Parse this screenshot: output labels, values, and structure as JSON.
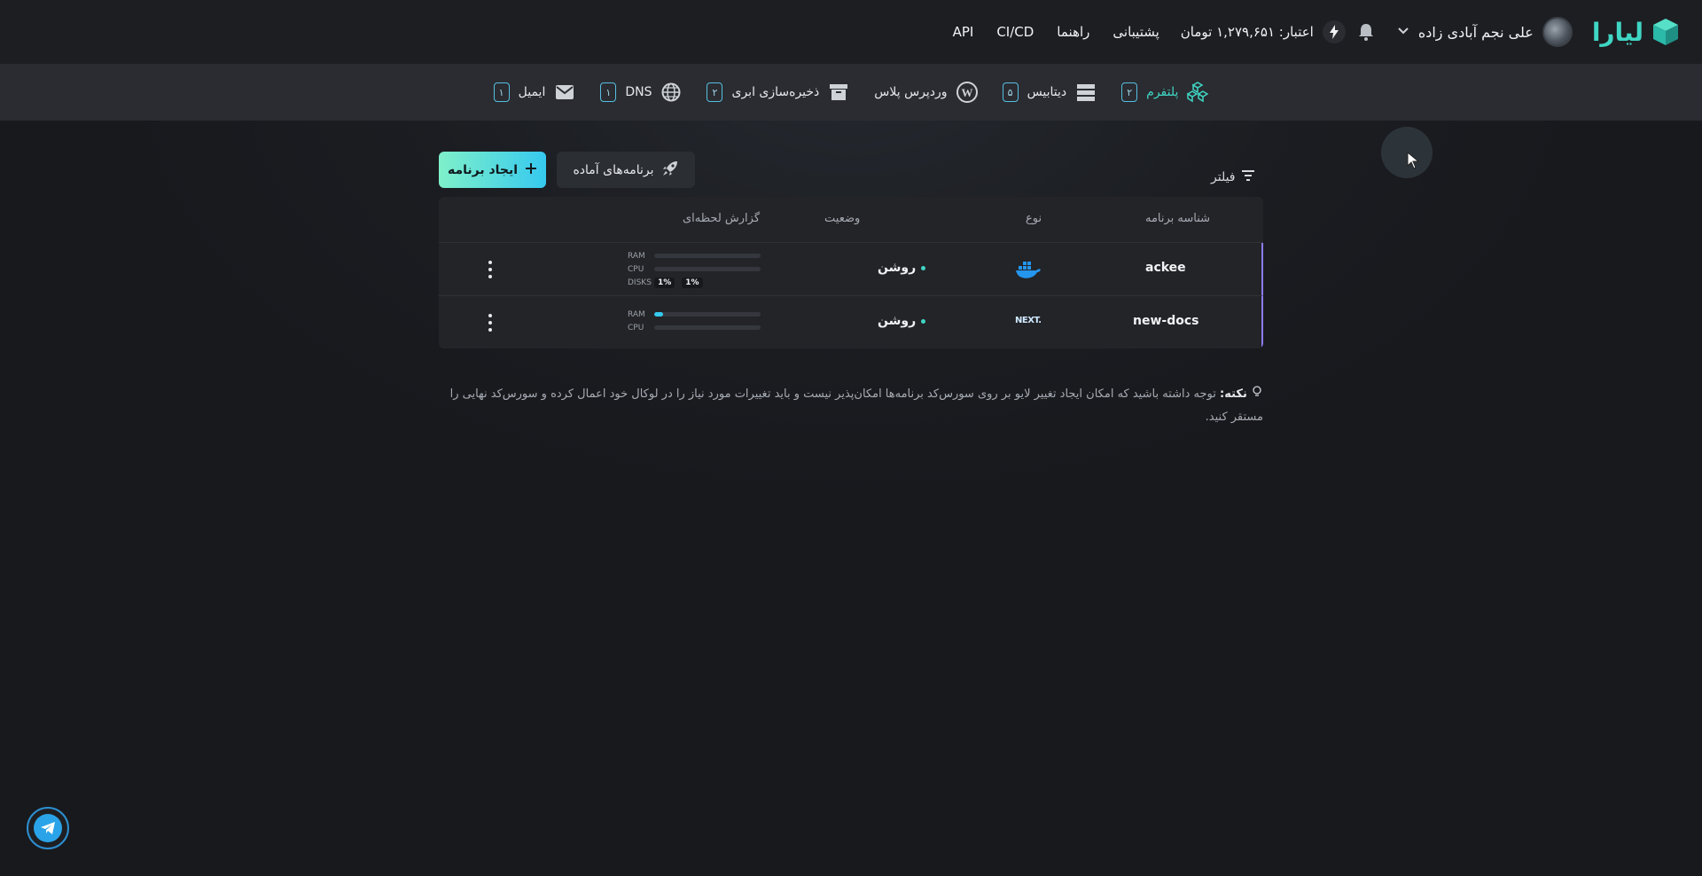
{
  "brand": {
    "name": "لیارا"
  },
  "header": {
    "user_name": "علی نجم آبادی زاده",
    "credit": "اعتبار: ۱,۲۷۹,۶۵۱ تومان",
    "nav": [
      "پشتیبانی",
      "راهنما",
      "CI/CD",
      "API"
    ]
  },
  "services": [
    {
      "label": "پلتفرم",
      "count": "۲",
      "icon": "cubes-icon",
      "active": true
    },
    {
      "label": "دیتابیس",
      "count": "۵",
      "icon": "database-icon"
    },
    {
      "label": "وردپرس پلاس",
      "count": "",
      "icon": "wordpress-icon"
    },
    {
      "label": "ذخیره‌سازی ابری",
      "count": "۲",
      "icon": "archive-icon"
    },
    {
      "label": "DNS",
      "count": "۱",
      "icon": "globe-icon"
    },
    {
      "label": "ایمیل",
      "count": "۱",
      "icon": "mail-icon"
    }
  ],
  "actions": {
    "create_label": "ایجاد برنامه",
    "ready_label": "برنامه‌های آماده",
    "filter_label": "فیلتر"
  },
  "table": {
    "headers": {
      "app_id": "شناسه برنامه",
      "type": "نوع",
      "status": "وضعیت",
      "report": "گزارش لحظه‌ای"
    },
    "rows": [
      {
        "app_id": "ackee",
        "type_icon": "docker-icon",
        "status": "روشن",
        "ram_label": "RAM",
        "cpu_label": "CPU",
        "disks_label": "DISKS",
        "ram": 0,
        "cpu": 0,
        "disk1": "1%",
        "disk2": "1%"
      },
      {
        "app_id": "new-docs",
        "type_icon": "nextjs-icon",
        "type_text": "NEXT.",
        "status": "روشن",
        "ram_label": "RAM",
        "cpu_label": "CPU",
        "ram": 0.08,
        "cpu": 0
      }
    ]
  },
  "note": {
    "title": "نکته:",
    "text": "توجه داشته باشید که امکان ایجاد تغییر لایو بر روی سورس‌کد برنامه‌ها امکان‌پذیر نیست و باید تغییرات مورد نیاز را در لوکال خود اعمال کرده و سورس‌کد نهایی را مستقر کنید."
  },
  "colors": {
    "accent": "#3fd6c4",
    "row_marker": "#8a7cf0",
    "bar_fill": "#36c9ef"
  },
  "floating": {
    "telegram": "telegram-icon"
  }
}
